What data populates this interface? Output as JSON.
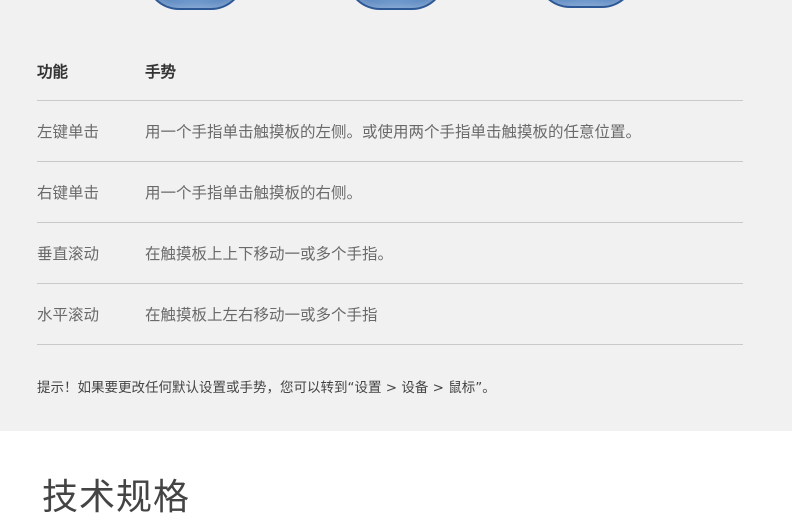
{
  "table": {
    "header": {
      "function": "功能",
      "gesture": "手势"
    },
    "rows": [
      {
        "function": "左键单击",
        "gesture": "用一个手指单击触摸板的左侧。或使用两个手指单击触摸板的任意位置。"
      },
      {
        "function": "右键单击",
        "gesture": "用一个手指单击触摸板的右侧。"
      },
      {
        "function": "垂直滚动",
        "gesture": "在触摸板上上下移动一或多个手指。"
      },
      {
        "function": "水平滚动",
        "gesture": "在触摸板上左右移动一或多个手指"
      }
    ]
  },
  "tip": "提示！如果要更改任何默认设置或手势，您可以转到“设置 > 设备 > 鼠标”。",
  "section_title": "技术规格",
  "colors": {
    "panel_background": "#f1f1f1",
    "illustration_blue": "#5f8cc4"
  }
}
